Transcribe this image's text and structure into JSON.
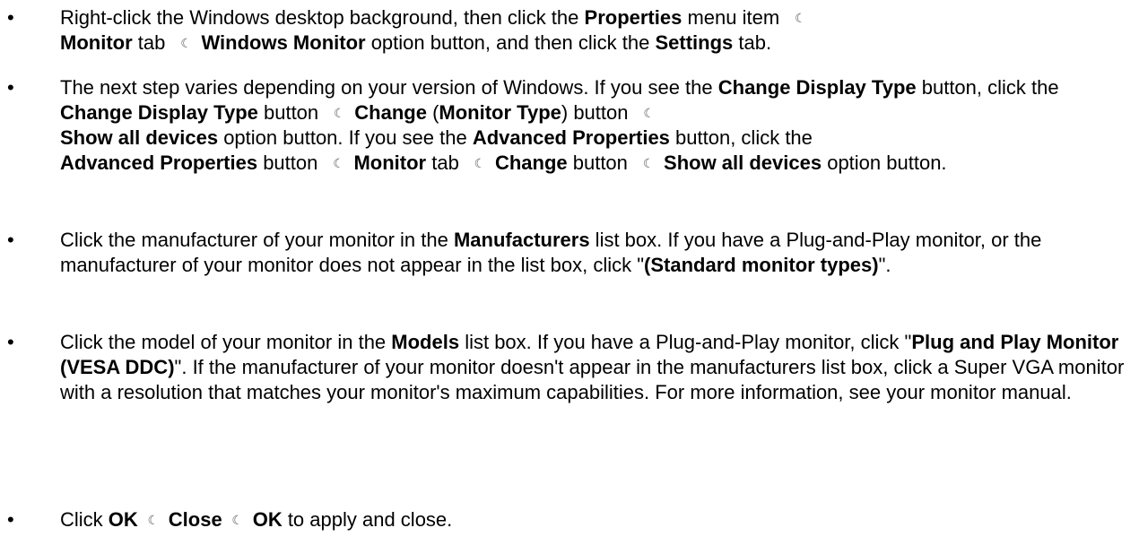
{
  "bullet_glyph": "•",
  "separator_glyph": "☾",
  "steps": [
    {
      "s0": "Right-click the Windows desktop background, then click the ",
      "b0": "Properties",
      "s1": " menu item ",
      "b1": "Monitor",
      "s2": " tab ",
      "b2": "Windows Monitor",
      "s3": " option button, and then click the ",
      "b3": "Settings",
      "s4": " tab."
    },
    {
      "s0": "The next step varies depending on your version of Windows. If you see the ",
      "b0": "Change Display Type",
      "s1": " button, click the ",
      "b1": "Change Display Type",
      "s2": " button ",
      "b2": "Change",
      "s3": " (",
      "b3": "Monitor Type",
      "s4": ") button ",
      "b4": "Show all devices",
      "s5": " option button. If you see the ",
      "b5": "Advanced Properties",
      "s6": " button, click the ",
      "b6": "Advanced Properties",
      "s7": " button ",
      "b7": "Monitor",
      "s8": " tab ",
      "b8": "Change",
      "s9": " button ",
      "b9": "Show all devices",
      "s10": " option button."
    },
    {
      "s0": "Click the manufacturer of your monitor in the ",
      "b0": "Manufacturers",
      "s1": " list box. If you have a Plug-and-Play monitor, or the manufacturer of your monitor does not appear in the list box, click \"",
      "b1": "(Standard monitor types)",
      "s2": "\"."
    },
    {
      "s0": "Click the model of your monitor in the ",
      "b0": "Models",
      "s1": " list box. If you have a Plug-and-Play monitor, click \"",
      "b1": "Plug and Play Monitor (VESA DDC)",
      "s2": "\". If the manufacturer of your monitor doesn't appear in the manufacturers list box, click a Super VGA monitor with a resolution that matches your monitor's maximum capabilities. For more information, see your monitor manual."
    },
    {
      "s0": "Click ",
      "b0": "OK",
      "b1": "Close",
      "b2": "OK",
      "s1": " to apply and close."
    }
  ]
}
